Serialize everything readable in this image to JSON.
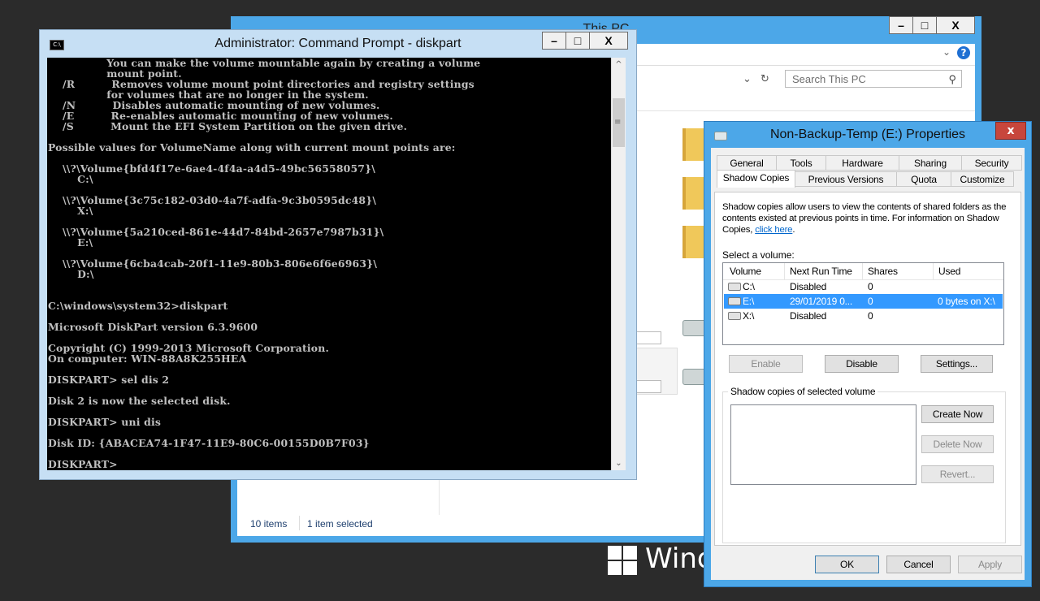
{
  "desktop": {
    "brand_text": "Windo"
  },
  "explorer": {
    "title": "This PC",
    "search_placeholder": "Search This PC",
    "status_items": "10 items",
    "status_selected": "1 item selected"
  },
  "cmd": {
    "title": "Administrator: Command Prompt - diskpart",
    "lines": [
      "                You can make the volume mountable again by creating a volume",
      "                mount point.",
      "    /R          Removes volume mount point directories and registry settings",
      "                for volumes that are no longer in the system.",
      "    /N          Disables automatic mounting of new volumes.",
      "    /E          Re-enables automatic mounting of new volumes.",
      "    /S          Mount the EFI System Partition on the given drive.",
      "",
      "Possible values for VolumeName along with current mount points are:",
      "",
      "    \\\\?\\Volume{bfd4f17e-6ae4-4f4a-a4d5-49bc56558057}\\",
      "        C:\\",
      "",
      "    \\\\?\\Volume{3c75c182-03d0-4a7f-adfa-9c3b0595dc48}\\",
      "        X:\\",
      "",
      "    \\\\?\\Volume{5a210ced-861e-44d7-84bd-2657e7987b31}\\",
      "        E:\\",
      "",
      "    \\\\?\\Volume{6cba4cab-20f1-11e9-80b3-806e6f6e6963}\\",
      "        D:\\",
      "",
      "",
      "C:\\windows\\system32>diskpart",
      "",
      "Microsoft DiskPart version 6.3.9600",
      "",
      "Copyright (C) 1999-2013 Microsoft Corporation.",
      "On computer: WIN-88A8K255HEA",
      "",
      "DISKPART> sel dis 2",
      "",
      "Disk 2 is now the selected disk.",
      "",
      "DISKPART> uni dis",
      "",
      "Disk ID: {ABACEA74-1F47-11E9-80C6-00155D0B7F03}",
      "",
      "DISKPART>"
    ]
  },
  "props": {
    "title": "Non-Backup-Temp (E:) Properties",
    "tabs_row1": [
      "General",
      "Tools",
      "Hardware",
      "Sharing",
      "Security"
    ],
    "tabs_row2": [
      "Shadow Copies",
      "Previous Versions",
      "Quota",
      "Customize"
    ],
    "active_tab": "Shadow Copies",
    "description": "Shadow copies allow users to view the contents of shared folders as the contents existed at previous points in time. For information on Shadow Copies,",
    "link_text": "click here",
    "select_label": "Select a volume:",
    "columns": [
      "Volume",
      "Next Run Time",
      "Shares",
      "Used"
    ],
    "volumes": [
      {
        "volume": "C:\\",
        "next_run": "Disabled",
        "shares": "0",
        "used": ""
      },
      {
        "volume": "E:\\",
        "next_run": "29/01/2019 0...",
        "shares": "0",
        "used": "0 bytes on X:\\"
      },
      {
        "volume": "X:\\",
        "next_run": "Disabled",
        "shares": "0",
        "used": ""
      }
    ],
    "enable_label": "Enable",
    "disable_label": "Disable",
    "settings_label": "Settings...",
    "group_title": "Shadow copies of selected volume",
    "create_now": "Create Now",
    "delete_now": "Delete Now",
    "revert": "Revert...",
    "ok": "OK",
    "cancel": "Cancel",
    "apply": "Apply"
  }
}
